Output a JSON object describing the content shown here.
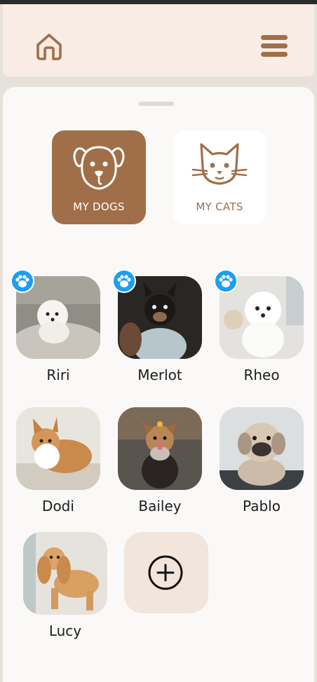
{
  "header": {
    "home_icon": "home-icon",
    "menu_icon": "hamburger-menu-icon",
    "accent_color": "#a06f4a",
    "header_bg": "#f8ece4"
  },
  "categories": [
    {
      "label": "MY DOGS",
      "icon": "dog-face-icon",
      "selected": true
    },
    {
      "label": "MY CATS",
      "icon": "cat-face-icon",
      "selected": false
    }
  ],
  "pets": [
    {
      "name": "Riri",
      "badge": "paw-icon"
    },
    {
      "name": "Merlot",
      "badge": "paw-icon"
    },
    {
      "name": "Rheo",
      "badge": "paw-icon"
    },
    {
      "name": "Dodi",
      "badge": null
    },
    {
      "name": "Bailey",
      "badge": null
    },
    {
      "name": "Pablo",
      "badge": null
    },
    {
      "name": "Lucy",
      "badge": null
    }
  ],
  "add_pet": {
    "icon": "plus-circle-icon"
  },
  "badge_color": "#1e9df1"
}
